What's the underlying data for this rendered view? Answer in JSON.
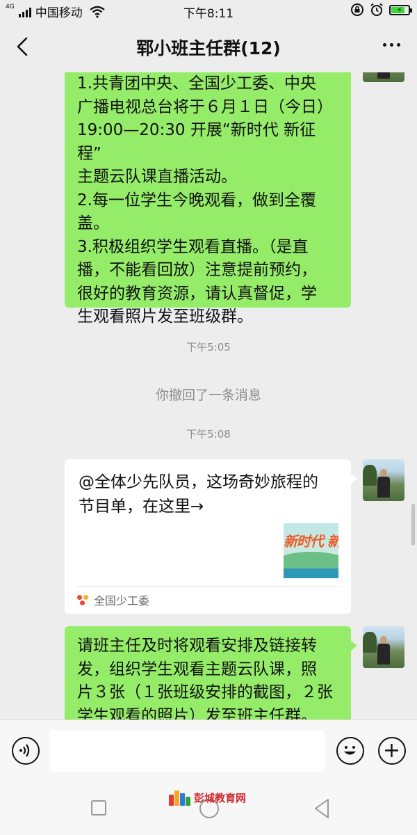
{
  "status_bar": {
    "network": "4G",
    "carrier": "中国移动",
    "time": "下午8:11",
    "battery_level": 0.8
  },
  "nav": {
    "title": "郓小班主任群(12)",
    "back_icon": "chevron-left-icon",
    "more_icon": "more-dots-icon"
  },
  "messages": [
    {
      "type": "outgoing-text",
      "lines": [
        "1.共青团中央、全国少工委、中央",
        "广播电视总台将于６月１日（今日）",
        "19:00—20:30 开展“新时代 新征程”",
        "主题云队课直播活动。",
        "2.每一位学生今晚观看，做到全覆",
        "盖。",
        "3.积极组织学生观看直播。（是直",
        "播，不能看回放）注意提前预约，",
        "很好的教育资源，请认真督促，学",
        "生观看照片发至班级群。"
      ]
    },
    {
      "type": "time",
      "text": "下午5:05"
    },
    {
      "type": "system",
      "text": "你撤回了一条消息"
    },
    {
      "type": "time",
      "text": "下午5:08"
    },
    {
      "type": "outgoing-card",
      "lines": [
        "@全体少先队员，这场奇妙旅程的",
        "节目单，在这里→"
      ],
      "thumbnail_text": "新时代 新征程",
      "source": "全国少工委"
    },
    {
      "type": "outgoing-text",
      "lines": [
        "请班主任及时将观看安排及链接转",
        "发，组织学生观看主题云队课，照",
        "片３张（１张班级安排的截图，２张",
        "学生观看的照片）发至班主任群。"
      ]
    }
  ],
  "input_bar": {
    "voice_icon": "voice-icon",
    "emoji_icon": "emoji-icon",
    "plus_icon": "plus-icon",
    "input_value": ""
  },
  "watermark": {
    "text": "彭城教育网"
  },
  "colors": {
    "background": "#ededed",
    "outgoing_bubble": "#95ec69",
    "card_bubble": "#ffffff",
    "meta_text": "#8c8c8c",
    "watermark": "#d2282e"
  }
}
